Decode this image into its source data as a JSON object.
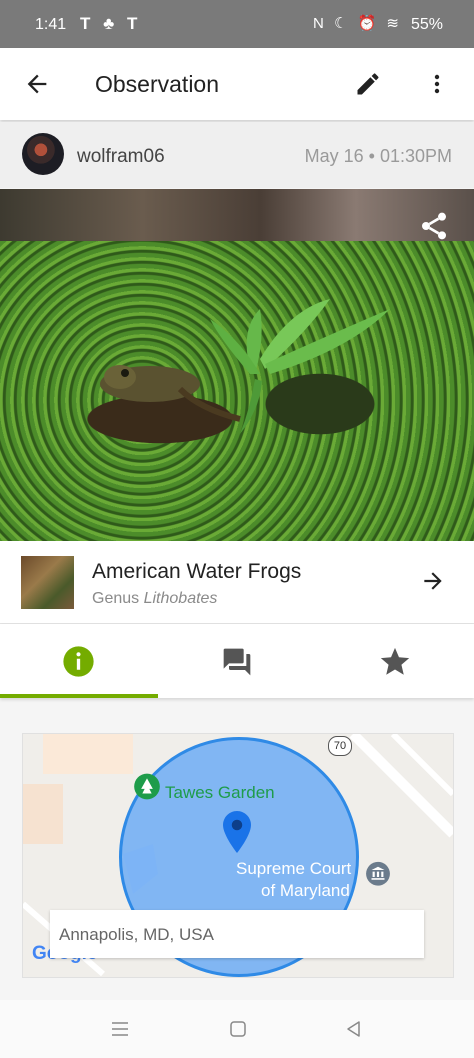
{
  "status_bar": {
    "time": "1:41",
    "left_icons": "T ♣ T",
    "right_icons": "N ☾ ⏰ ≋",
    "battery": "55%"
  },
  "app_bar": {
    "title": "Observation"
  },
  "observation": {
    "username": "wolfram06",
    "date": "May 16 • 01:30PM"
  },
  "taxon": {
    "common_name": "American Water Frogs",
    "rank": "Genus",
    "scientific_name": "Lithobates"
  },
  "tabs": [
    {
      "name": "info",
      "icon": "info-icon",
      "active": true
    },
    {
      "name": "activity",
      "icon": "comments-icon",
      "active": false
    },
    {
      "name": "favorites",
      "icon": "star-icon",
      "active": false
    }
  ],
  "map": {
    "poi_1": "Tawes Garden",
    "poi_2_line1": "Supreme Court",
    "poi_2_line2": "of Maryland",
    "route": "70",
    "location": "Annapolis, MD, USA",
    "attribution": "Google"
  },
  "colors": {
    "accent": "#74ac00",
    "status_bar": "#7a7a7a",
    "map_circle": "#5ca3f5",
    "poi_green": "#1e9c4a"
  }
}
